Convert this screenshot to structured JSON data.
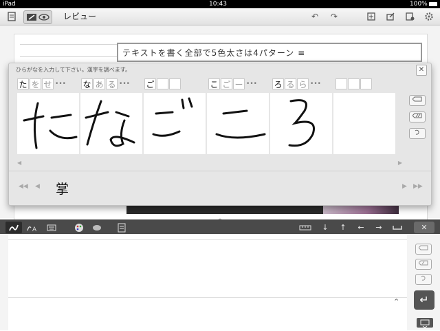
{
  "status_bar": {
    "carrier": "iPad",
    "time": "10:43",
    "battery": "100%"
  },
  "toolbar": {
    "title": "レビュー",
    "undo_label": "↶",
    "redo_label": "↷"
  },
  "document": {
    "title_text": "テキストを書く全部で5色太さは4パターン ≡"
  },
  "hw_panel": {
    "instruction": "ひらがなを入力して下さい。漢字を調べます。",
    "candidates": [
      [
        "た",
        "を",
        "せ"
      ],
      [
        "な",
        "あ",
        "る"
      ],
      [
        "ご",
        "",
        ""
      ],
      [
        "こ",
        "ご",
        "ー"
      ],
      [
        "ろ",
        "る",
        "ら"
      ],
      [
        "",
        "",
        ""
      ]
    ],
    "more_label": "•••",
    "kanji": "掌",
    "close_label": "✕"
  },
  "input_toolbar": {
    "close_label": "✕"
  },
  "icons": {
    "enter": "↵",
    "up": "↑",
    "down": "↓",
    "left": "←",
    "right": "→"
  },
  "colors": {
    "toolbar_dark": "#4a4a4a",
    "panel_bg": "#e6e6e6"
  }
}
